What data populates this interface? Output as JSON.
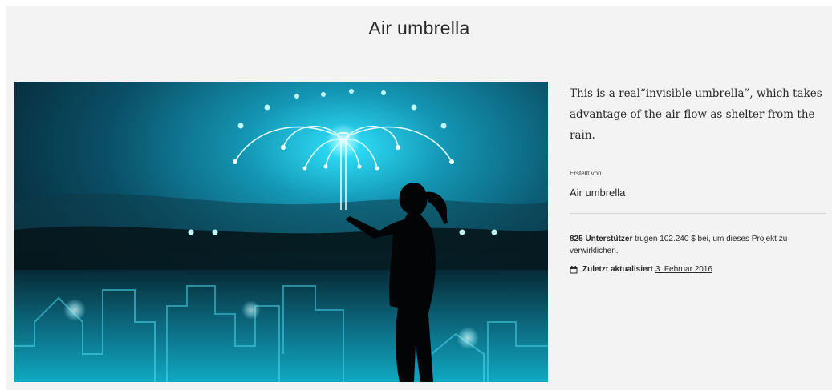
{
  "page": {
    "title": "Air umbrella"
  },
  "hero": {
    "image": "air-umbrella-illustration"
  },
  "project": {
    "description": "This is a real“invisible umbrella”, which takes advantage of the air flow as shelter from the rain.",
    "created_by_label": "Erstellt von",
    "creator": "Air umbrella",
    "backers_count": "825 Unterstützer",
    "backers_text": " trugen 102.240 $ bei, um dieses Projekt zu verwirklichen.",
    "updated_label": "Zuletzt aktualisiert",
    "updated_date": "3. Februar 2016",
    "updated_icon": "calendar-icon"
  },
  "colors": {
    "page_bg": "#f3f3f3",
    "text": "#282828",
    "glow": "#3fe6ff"
  }
}
